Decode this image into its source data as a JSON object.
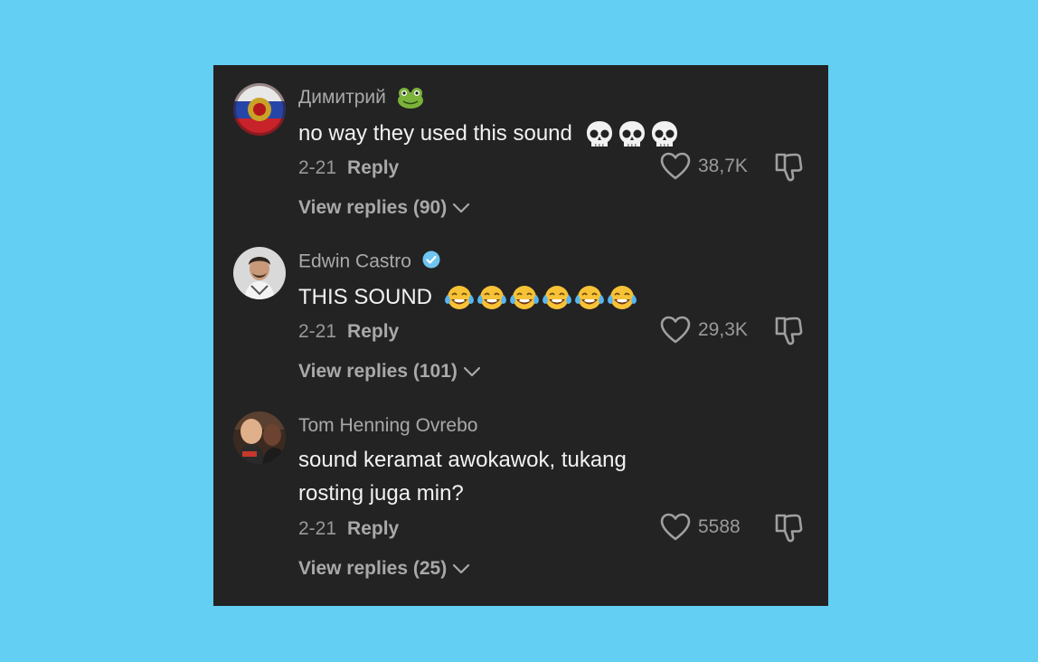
{
  "comments": [
    {
      "username": "Димитрий",
      "username_emoji": "frog-emoji",
      "text": "no way they used this sound",
      "text_emoji": "skull-emoji",
      "text_emoji_count": 3,
      "date": "2-21",
      "reply_label": "Reply",
      "likes": "38,7K",
      "view_replies": "View replies (90)"
    },
    {
      "username": "Edwin Castro",
      "verified": true,
      "text": "THIS SOUND",
      "text_emoji": "tears-of-joy-emoji",
      "text_emoji_count": 6,
      "date": "2-21",
      "reply_label": "Reply",
      "likes": "29,3K",
      "view_replies": "View replies (101)"
    },
    {
      "username": "Tom Henning Ovrebo",
      "text": "sound keramat awokawok, tukang rosting juga min?",
      "date": "2-21",
      "reply_label": "Reply",
      "likes": "5588",
      "view_replies": "View replies (25)"
    }
  ],
  "colors": {
    "background": "#63cff3",
    "panel": "#232323",
    "text": "#f2f2f2",
    "muted": "#a9a9a9",
    "verified": "#6fc5f2"
  }
}
